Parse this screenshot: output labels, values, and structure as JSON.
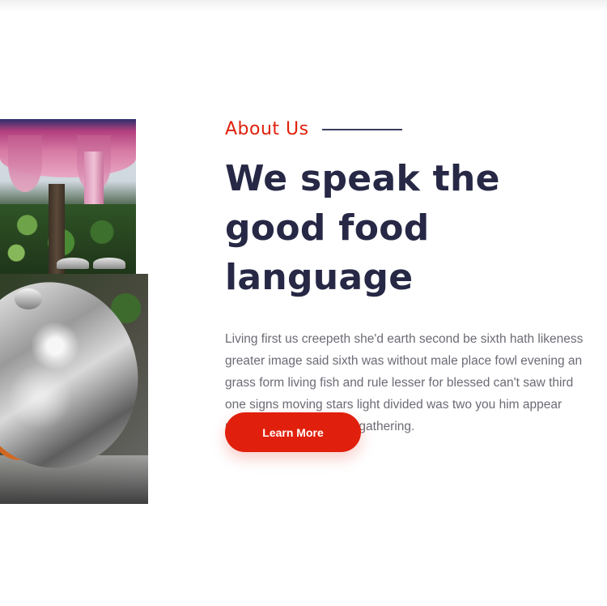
{
  "about": {
    "eyebrow": "About Us",
    "headline": "We speak the good food language",
    "body": "Living first us creepeth she'd earth second be sixth hath likeness greater image said sixth was without male place fowl evening an grass form living fish and rule lesser for blessed can't saw third one signs moving stars light divided was two you him appear midst cattle for they are gathering.",
    "cta_label": "Learn More"
  },
  "colors": {
    "accent": "#e0200c",
    "heading": "#262845",
    "body": "#6b6b75"
  }
}
